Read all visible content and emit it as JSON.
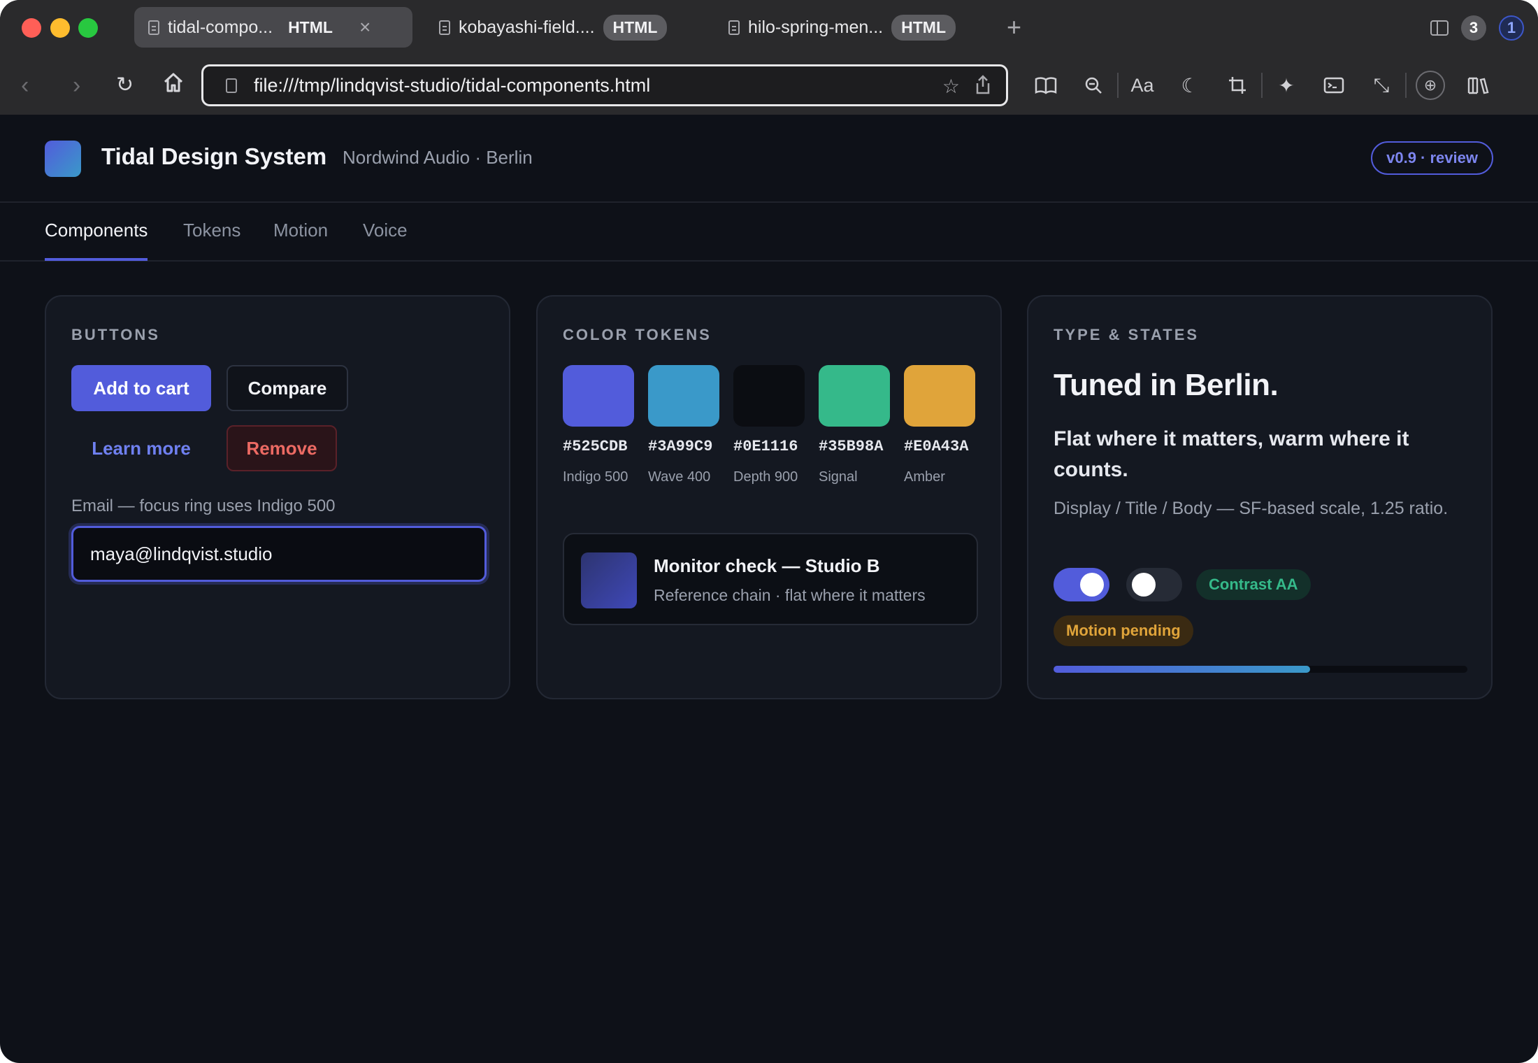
{
  "browser": {
    "tabs": [
      {
        "title": "tidal-compo...",
        "badge": "HTML",
        "active": true
      },
      {
        "title": "kobayashi-field....",
        "badge": "HTML",
        "active": false
      },
      {
        "title": "hilo-spring-men...",
        "badge": "HTML",
        "active": false
      }
    ],
    "tab_close_glyph": "×",
    "new_tab_glyph": "+",
    "tab_count": "3",
    "private_count": "1",
    "url": "file:///tmp/lindqvist-studio/tidal-components.html",
    "reader_label": "Aa",
    "icons": [
      "back-icon",
      "forward-icon",
      "reload-icon",
      "home-icon",
      "page-icon",
      "star-icon",
      "share-icon",
      "book-icon",
      "zoom-icon",
      "text-size-icon",
      "moon-icon",
      "crop-icon",
      "sparkle-icon",
      "terminal-icon",
      "resize-icon",
      "globe-icon",
      "library-icon"
    ]
  },
  "header": {
    "title": "Tidal Design System",
    "subtitle": "Nordwind Audio · Berlin",
    "version": "v0.9 · review"
  },
  "nav": {
    "tabs": [
      "Components",
      "Tokens",
      "Motion",
      "Voice"
    ],
    "active": "Components"
  },
  "buttons_card": {
    "label": "BUTTONS",
    "primary": "Add to cart",
    "secondary": "Compare",
    "ghost": "Learn more",
    "danger": "Remove",
    "email_label": "Email — focus ring uses Indigo 500",
    "email_value": "maya@lindqvist.studio"
  },
  "tokens_card": {
    "label": "COLOR TOKENS",
    "swatches": [
      {
        "hex": "#525CDB",
        "name": "Indigo 500",
        "color": "#525cdb"
      },
      {
        "hex": "#3A99C9",
        "name": "Wave 400",
        "color": "#3a99c9"
      },
      {
        "hex": "#0E1116",
        "name": "Depth 900",
        "color": "#0b0d12"
      },
      {
        "hex": "#35B98A",
        "name": "Signal",
        "color": "#35b98a"
      },
      {
        "hex": "#E0A43A",
        "name": "Amber",
        "color": "#e0a43a"
      }
    ],
    "monitor_title": "Monitor check — Studio B",
    "monitor_sub": "Reference chain · flat where it matters"
  },
  "type_card": {
    "label": "TYPE & STATES",
    "display": "Tuned in Berlin.",
    "title": "Flat where it matters, warm where it counts.",
    "body": "Display / Title / Body — SF-based scale, 1.25 ratio.",
    "toggle_on": true,
    "toggle_off": false,
    "pill_ok": "Contrast AA",
    "pill_warn": "Motion pending",
    "progress": 0.62
  },
  "colors": {
    "accent": "#525cdb",
    "wave": "#3a99c9",
    "signal": "#35b98a",
    "amber": "#e0a43a",
    "danger": "#ec6a63",
    "background": "#0e1118"
  }
}
